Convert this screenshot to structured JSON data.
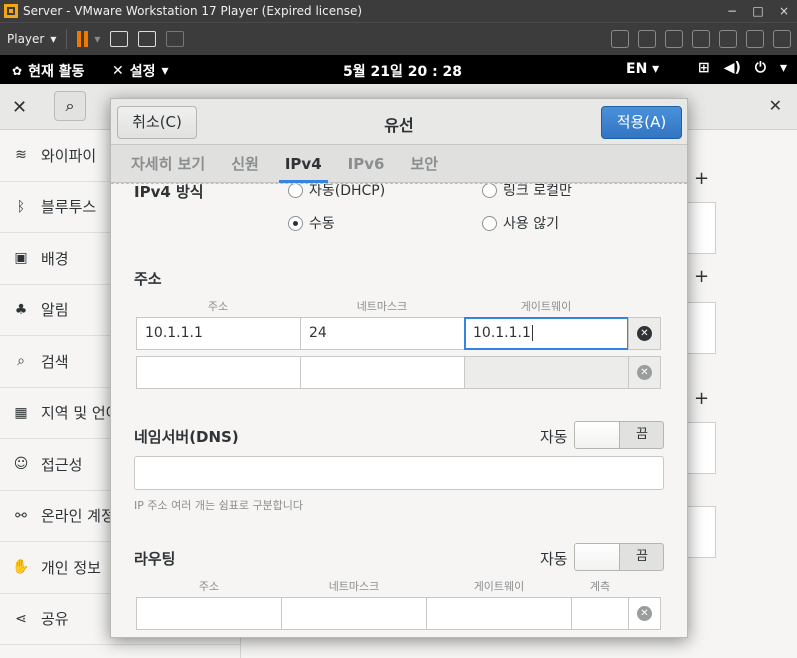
{
  "vmware": {
    "title": "Server - VMware Workstation 17 Player (Expired license)",
    "player_menu": "Player",
    "window_controls": {
      "minimize": "−",
      "maximize": "□",
      "close": "×"
    }
  },
  "gnome": {
    "activities": "현재 활동",
    "settings_menu": "설정",
    "clock": "5월 21일  20 : 28",
    "language": "EN"
  },
  "settings": {
    "sidebar": [
      {
        "icon": "wifi-icon",
        "label": "와이파이"
      },
      {
        "icon": "bluetooth-icon",
        "label": "블루투스"
      },
      {
        "icon": "background-icon",
        "label": "배경"
      },
      {
        "icon": "bell-icon",
        "label": "알림"
      },
      {
        "icon": "search-icon",
        "label": "검색"
      },
      {
        "icon": "region-icon",
        "label": "지역 및 언어"
      },
      {
        "icon": "accessibility-icon",
        "label": "접근성"
      },
      {
        "icon": "online-accounts-icon",
        "label": "온라인 계정"
      },
      {
        "icon": "hand-icon",
        "label": "개인 정보"
      },
      {
        "icon": "share-icon",
        "label": "공유"
      }
    ]
  },
  "dialog": {
    "cancel_label": "취소(C)",
    "title": "유선",
    "apply_label": "적용(A)",
    "tabs": [
      "자세히 보기",
      "신원",
      "IPv4",
      "IPv6",
      "보안"
    ],
    "active_tab": "IPv4",
    "ipv4_method": {
      "label": "IPv4 방식",
      "options": [
        "자동(DHCP)",
        "링크 로컬만",
        "수동",
        "사용 않기"
      ],
      "selected": "수동"
    },
    "addresses": {
      "label": "주소",
      "headers": [
        "주소",
        "네트마스크",
        "게이트웨이"
      ],
      "rows": [
        {
          "address": "10.1.1.1",
          "netmask": "24",
          "gateway": "10.1.1.1"
        },
        {
          "address": "",
          "netmask": "",
          "gateway": ""
        }
      ]
    },
    "dns": {
      "label": "네임서버(DNS)",
      "auto_label": "자동",
      "toggle_state": "끔",
      "value": "",
      "hint": "IP 주소 여러 개는 쉼표로 구분합니다"
    },
    "routes": {
      "label": "라우팅",
      "auto_label": "자동",
      "toggle_state": "끔",
      "headers": [
        "주소",
        "네트마스크",
        "게이트웨이",
        "계측"
      ]
    }
  }
}
